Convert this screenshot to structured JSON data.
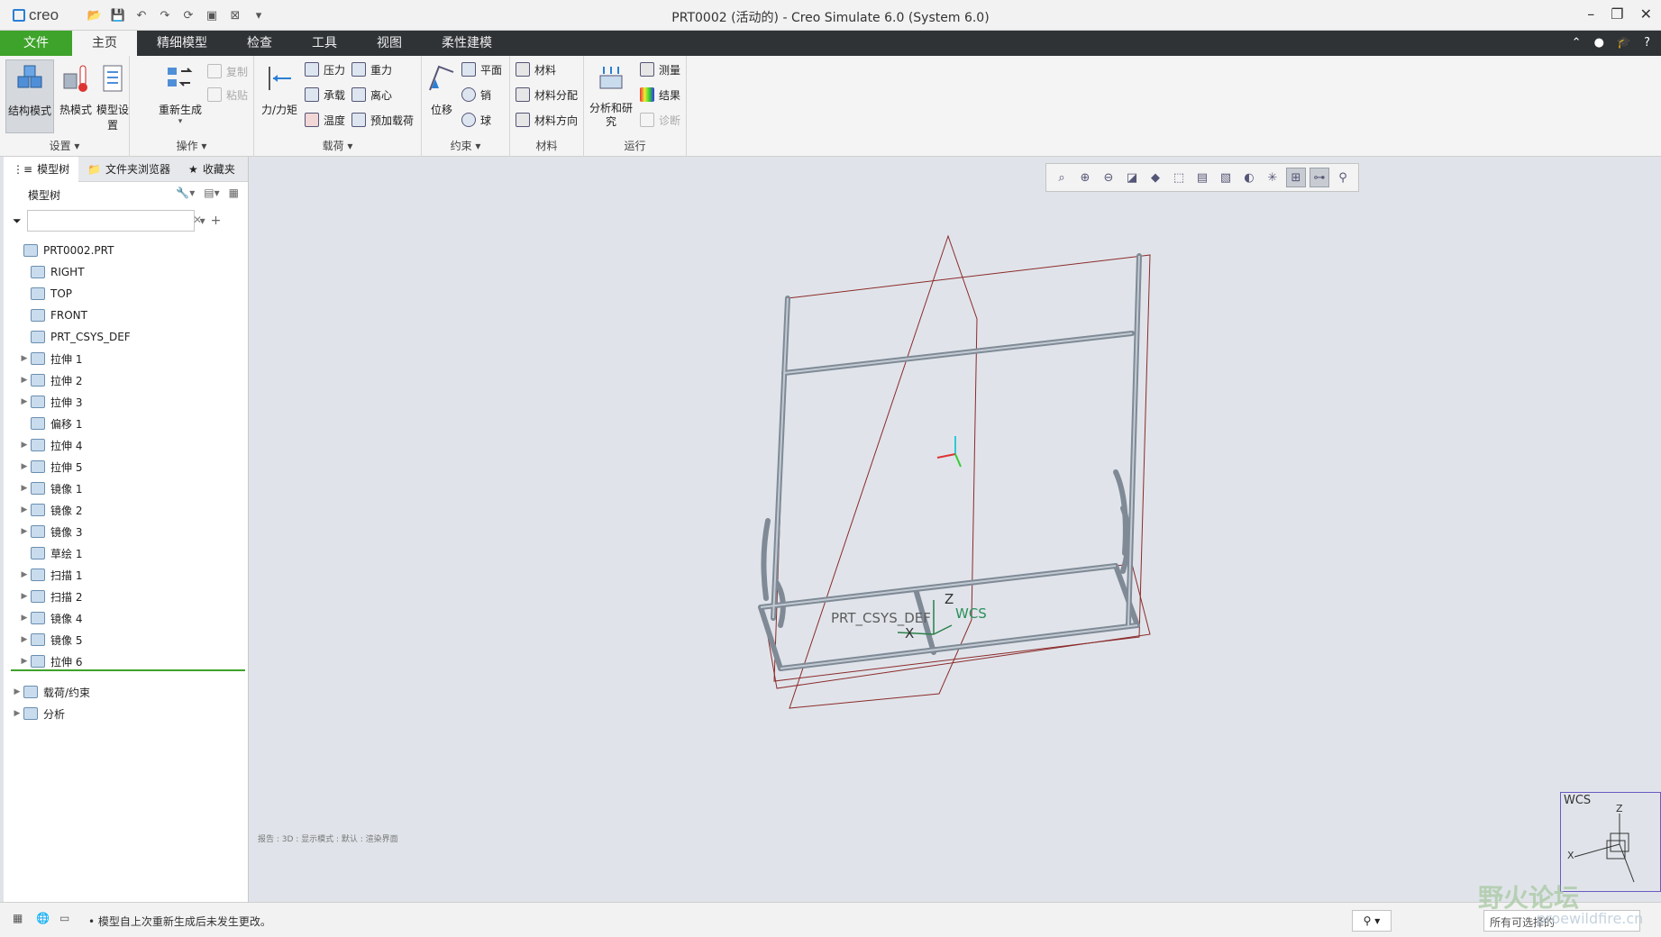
{
  "app": {
    "logo": "creo",
    "window_title": "PRT0002 (活动的) - Creo Simulate 6.0 (System 6.0)"
  },
  "tabs": [
    "文件",
    "主页",
    "精细模型",
    "检查",
    "工具",
    "视图",
    "柔性建模"
  ],
  "active_tab": "主页",
  "ribbon": {
    "settings": {
      "label": "设置",
      "structural": "结构模式",
      "thermal": "热模式",
      "model_setup": "模型设置"
    },
    "operations": {
      "label": "操作",
      "regenerate": "重新生成",
      "copy": "复制",
      "paste": "粘贴"
    },
    "loads": {
      "label": "载荷",
      "force_moment": "力/力矩",
      "pressure": "压力",
      "gravity": "重力",
      "bearing": "承载",
      "centrifugal": "离心",
      "temperature": "温度",
      "preload": "预加载荷"
    },
    "constraints": {
      "label": "约束",
      "displacement": "位移",
      "plane": "平面",
      "pin": "销",
      "ball": "球"
    },
    "materials": {
      "label": "材料",
      "material": "材料",
      "assignment": "材料分配",
      "orientation": "材料方向"
    },
    "run": {
      "label": "运行",
      "analyses": "分析和研究",
      "measure": "测量",
      "results": "结果",
      "diagnostics": "诊断"
    }
  },
  "left_pane": {
    "tabs": [
      "模型树",
      "文件夹浏览器",
      "收藏夹"
    ],
    "tree_header": "模型树",
    "filter_placeholder": "",
    "items": [
      {
        "label": "PRT0002.PRT",
        "expandable": false,
        "indent": 0
      },
      {
        "label": "RIGHT",
        "expandable": false,
        "indent": 1
      },
      {
        "label": "TOP",
        "expandable": false,
        "indent": 1
      },
      {
        "label": "FRONT",
        "expandable": false,
        "indent": 1
      },
      {
        "label": "PRT_CSYS_DEF",
        "expandable": false,
        "indent": 1
      },
      {
        "label": "拉伸 1",
        "expandable": true,
        "indent": 1
      },
      {
        "label": "拉伸 2",
        "expandable": true,
        "indent": 1
      },
      {
        "label": "拉伸 3",
        "expandable": true,
        "indent": 1
      },
      {
        "label": "偏移 1",
        "expandable": false,
        "indent": 1
      },
      {
        "label": "拉伸 4",
        "expandable": true,
        "indent": 1
      },
      {
        "label": "拉伸 5",
        "expandable": true,
        "indent": 1
      },
      {
        "label": "镜像 1",
        "expandable": true,
        "indent": 1
      },
      {
        "label": "镜像 2",
        "expandable": true,
        "indent": 1
      },
      {
        "label": "镜像 3",
        "expandable": true,
        "indent": 1
      },
      {
        "label": "草绘 1",
        "expandable": false,
        "indent": 1
      },
      {
        "label": "扫描 1",
        "expandable": true,
        "indent": 1
      },
      {
        "label": "扫描 2",
        "expandable": true,
        "indent": 1
      },
      {
        "label": "镜像 4",
        "expandable": true,
        "indent": 1
      },
      {
        "label": "镜像 5",
        "expandable": true,
        "indent": 1
      },
      {
        "label": "拉伸 6",
        "expandable": true,
        "indent": 1
      }
    ],
    "bottom_items": [
      {
        "label": "载荷/约束"
      },
      {
        "label": "分析"
      }
    ]
  },
  "viewport": {
    "status_text": "报告 : 3D : 显示模式 : 默认 : 渲染界面",
    "csys_label": "PRT_CSYS_DEF",
    "wcs_label": "WCS",
    "z_label": "Z",
    "x_label": "X",
    "wcs_corner_label": "WCS",
    "wcs_z": "Z",
    "wcs_x": "X"
  },
  "statusbar": {
    "message": "• 模型自上次重新生成后未发生更改。",
    "selection_filter": "所有可选择的"
  },
  "watermark": {
    "text": "野火论坛",
    "url_text": "proewildfire.cn"
  },
  "colors": {
    "file_tab": "#3ea32a",
    "tabbar": "#2f3336",
    "viewport": "#e0e4ea",
    "frame": "#9aa3ad",
    "datum": "#8b2a2a"
  }
}
